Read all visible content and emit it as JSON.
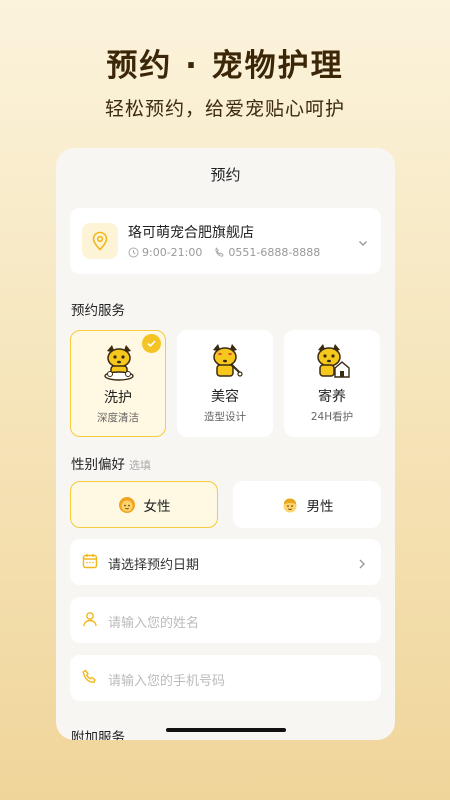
{
  "promo": {
    "headline": "预约 · 宠物护理",
    "subline": "轻松预约，给爱宠贴心呵护"
  },
  "card": {
    "title": "预约",
    "store": {
      "name": "珞可萌宠合肥旗舰店",
      "hours": "9:00-21:00",
      "phone": "0551-6888-8888"
    },
    "service_section": "预约服务",
    "services": [
      {
        "name": "洗护",
        "desc": "深度清洁",
        "selected": true
      },
      {
        "name": "美容",
        "desc": "造型设计",
        "selected": false
      },
      {
        "name": "寄养",
        "desc": "24H看护",
        "selected": false
      }
    ],
    "gender_section": "性别偏好",
    "gender_optional": "选填",
    "genders": [
      {
        "label": "女性",
        "selected": true
      },
      {
        "label": "男性",
        "selected": false
      }
    ],
    "date_field": "请选择预约日期",
    "name_placeholder": "请输入您的姓名",
    "phone_placeholder": "请输入您的手机号码",
    "extra_section": "附加服务"
  },
  "colors": {
    "accent": "#f4c324",
    "accent_bg": "#fff8e2",
    "heading": "#3b2608"
  }
}
